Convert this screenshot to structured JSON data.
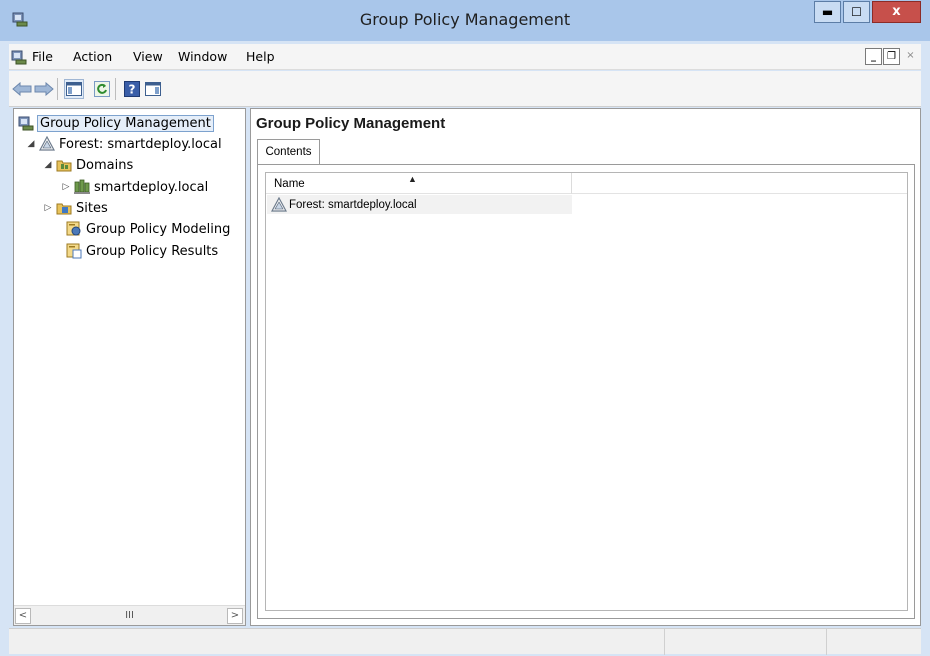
{
  "window": {
    "title": "Group Policy Management"
  },
  "caption": {
    "minimize": "▬",
    "maximize": "☐",
    "close": "x"
  },
  "menubar": {
    "items": [
      "File",
      "Action",
      "View",
      "Window",
      "Help"
    ],
    "mdi_minimize": "_",
    "mdi_restore": "❐",
    "mdi_close": "×"
  },
  "toolbar": {
    "buttons": [
      "back-arrow-icon",
      "forward-arrow-icon",
      "show-hide-console-tree-icon",
      "refresh-icon",
      "help-icon",
      "show-hide-action-pane-icon"
    ]
  },
  "tree": {
    "items": [
      {
        "label": "Group Policy Management",
        "expander": "",
        "icon": "gpm-console-icon",
        "selected": true
      },
      {
        "label": "Forest: smartdeploy.local",
        "expander": "◢",
        "icon": "forest-icon"
      },
      {
        "label": "Domains",
        "expander": "◢",
        "icon": "domains-icon"
      },
      {
        "label": "smartdeploy.local",
        "expander": "▷",
        "icon": "domain-icon"
      },
      {
        "label": "Sites",
        "expander": "▷",
        "icon": "sites-icon"
      },
      {
        "label": "Group Policy Modeling",
        "expander": "",
        "icon": "gp-modeling-icon"
      },
      {
        "label": "Group Policy Results",
        "expander": "",
        "icon": "gp-results-icon"
      }
    ],
    "scroll_left": "<",
    "scroll_right": ">",
    "scroll_thumb": "III"
  },
  "content": {
    "title": "Group Policy Management",
    "tab_label": "Contents",
    "columns": [
      "Name"
    ],
    "sort_indicator": "▲",
    "rows": [
      {
        "name": "Forest: smartdeploy.local",
        "icon": "forest-icon"
      }
    ]
  },
  "colors": {
    "titlebar": "#a9c6ea",
    "frame": "#d6e4f5",
    "close_button": "#c7504b",
    "selection_outline": "#7da2ce"
  }
}
